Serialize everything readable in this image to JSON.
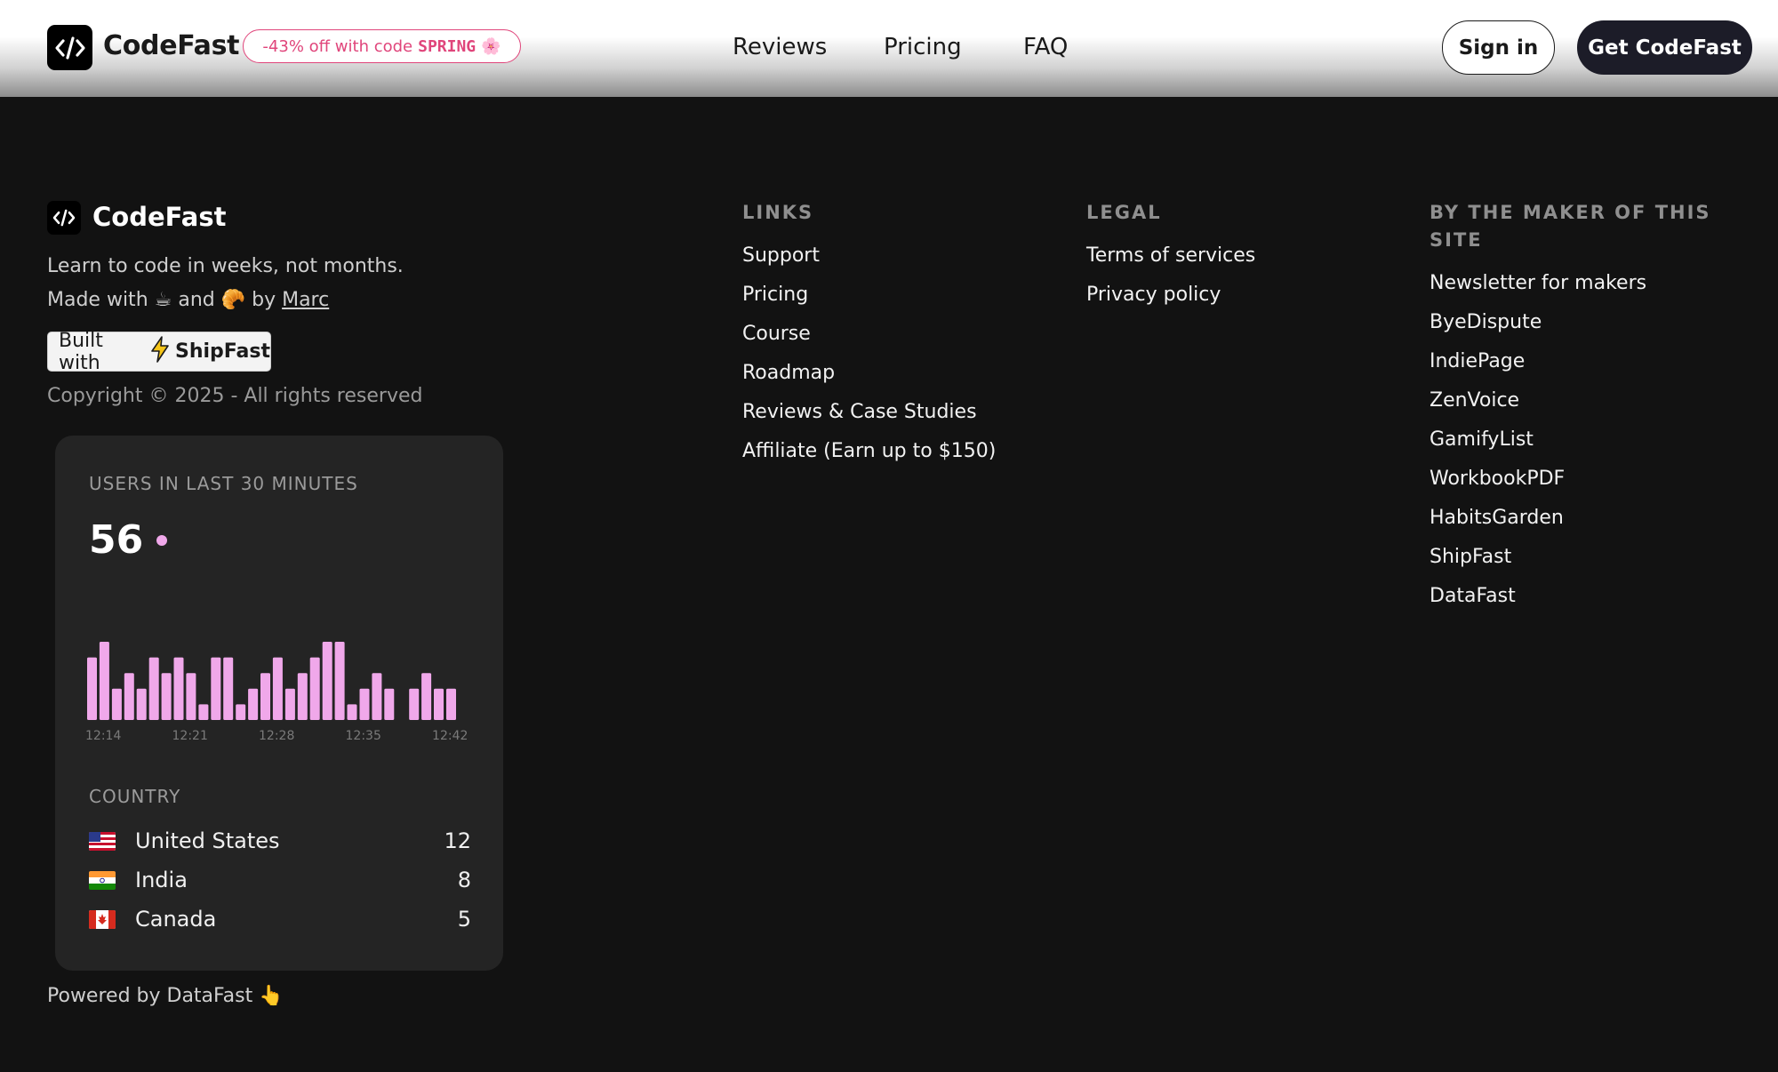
{
  "header": {
    "brand": "CodeFast",
    "promo_prefix": "-43% off with code ",
    "promo_code": "SPRING",
    "promo_emoji": "🌸",
    "nav": [
      "Reviews",
      "Pricing",
      "FAQ"
    ],
    "signin_label": "Sign in",
    "cta_label": "Get CodeFast"
  },
  "footer": {
    "brand": "CodeFast",
    "tagline": "Learn to code in weeks, not months.",
    "made_with_prefix": "Made with ☕ and 🥐 by ",
    "made_by": "Marc",
    "built_with": "Built with",
    "built_product": "ShipFast",
    "copyright": "Copyright © 2025 - All rights reserved",
    "powered_by": "Powered by DataFast 👆",
    "columns": {
      "links": {
        "title": "LINKS",
        "items": [
          "Support",
          "Pricing",
          "Course",
          "Roadmap",
          "Reviews & Case Studies",
          "Affiliate (Earn up to $150)"
        ]
      },
      "legal": {
        "title": "LEGAL",
        "items": [
          "Terms of services",
          "Privacy policy"
        ]
      },
      "maker": {
        "title_line1": "BY THE MAKER OF THIS",
        "title_line2": "SITE",
        "items": [
          "Newsletter for makers",
          "ByeDispute",
          "IndiePage",
          "ZenVoice",
          "GamifyList",
          "WorkbookPDF",
          "HabitsGarden",
          "ShipFast",
          "DataFast"
        ]
      }
    }
  },
  "analytics": {
    "title": "USERS IN LAST 30 MINUTES",
    "count": "56",
    "bar_color": "#f0a8ea",
    "country_title": "COUNTRY",
    "countries": [
      {
        "name": "United States",
        "value": "12"
      },
      {
        "name": "India",
        "value": "8"
      },
      {
        "name": "Canada",
        "value": "5"
      }
    ]
  },
  "chart_data": {
    "type": "bar",
    "x": [
      "12:14",
      "12:15",
      "12:16",
      "12:17",
      "12:18",
      "12:19",
      "12:20",
      "12:21",
      "12:22",
      "12:23",
      "12:24",
      "12:25",
      "12:26",
      "12:27",
      "12:28",
      "12:29",
      "12:30",
      "12:31",
      "12:32",
      "12:33",
      "12:34",
      "12:35",
      "12:36",
      "12:37",
      "12:38",
      "12:39",
      "12:40",
      "12:41",
      "12:42",
      "12:43"
    ],
    "values": [
      4,
      5,
      2,
      3,
      2,
      4,
      3,
      4,
      3,
      1,
      4,
      4,
      1,
      2,
      3,
      4,
      2,
      3,
      4,
      5,
      5,
      1,
      2,
      3,
      2,
      0,
      2,
      3,
      2,
      2
    ],
    "tick_labels": [
      "12:14",
      "12:21",
      "12:28",
      "12:35",
      "12:42"
    ]
  }
}
